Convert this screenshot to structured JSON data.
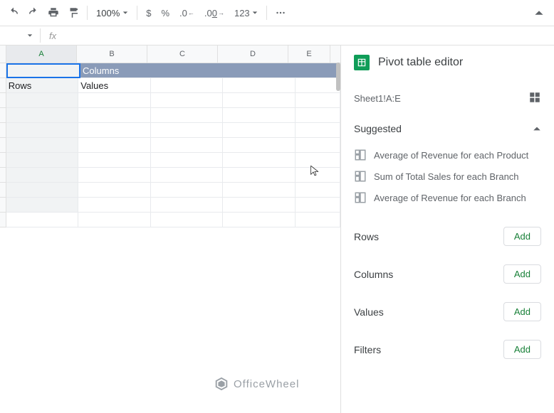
{
  "toolbar": {
    "zoom": "100%",
    "currency": "$",
    "percent": "%",
    "dec_dec": ".0",
    "inc_dec": ".00",
    "num_fmt": "123"
  },
  "formula_bar": {
    "fx": "fx"
  },
  "columns": [
    "A",
    "B",
    "C",
    "D",
    "E"
  ],
  "pivot_cells": {
    "columns_header": "Columns",
    "rows_label": "Rows",
    "values_label": "Values"
  },
  "panel": {
    "title": "Pivot table editor",
    "range": "Sheet1!A:E",
    "suggested_title": "Suggested",
    "suggestions": [
      "Average of Revenue for each Product",
      "Sum of Total Sales for each Branch",
      "Average of Revenue for each Branch"
    ],
    "rows_label": "Rows",
    "columns_label": "Columns",
    "values_label": "Values",
    "filters_label": "Filters",
    "add_label": "Add"
  },
  "watermark": "OfficeWheel"
}
